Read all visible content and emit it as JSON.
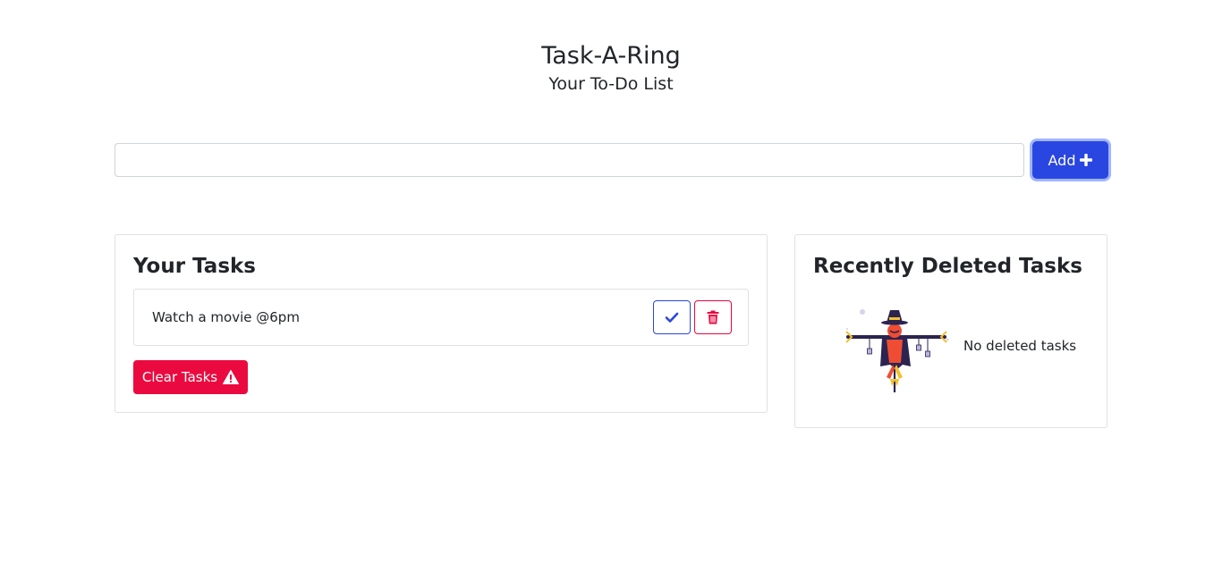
{
  "header": {
    "title": "Task-A-Ring",
    "subtitle": "Your To-Do List"
  },
  "input": {
    "value": "",
    "placeholder": ""
  },
  "add_button": {
    "label": "Add",
    "icon": "plus-icon"
  },
  "tasks_panel": {
    "title": "Your Tasks",
    "tasks": [
      {
        "text": "Watch a movie @6pm",
        "complete_icon": "check-icon",
        "delete_icon": "trash-icon"
      }
    ],
    "clear_button": {
      "label": "Clear Tasks",
      "icon": "warning-icon"
    }
  },
  "deleted_panel": {
    "title": "Recently Deleted Tasks",
    "empty_text": "No deleted tasks",
    "illustration": "scarecrow-illustration"
  },
  "colors": {
    "primary": "#2a46e0",
    "danger": "#ea0a3f",
    "border": "#dfe1e4",
    "text": "#212529"
  }
}
